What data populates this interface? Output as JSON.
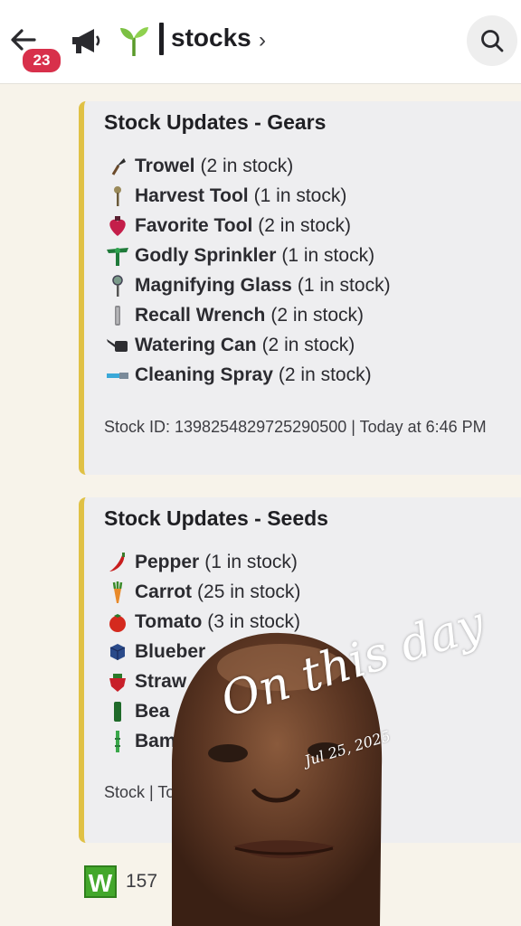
{
  "header": {
    "badge_count": "23",
    "channel_name": "stocks",
    "chevron": "›"
  },
  "embeds": [
    {
      "title": "Stock Updates - Gears",
      "items": [
        {
          "icon": "trowel-icon",
          "name": "Trowel",
          "stock": "(2 in stock)"
        },
        {
          "icon": "harvest-tool-icon",
          "name": "Harvest Tool",
          "stock": "(1 in stock)"
        },
        {
          "icon": "favorite-tool-icon",
          "name": "Favorite Tool",
          "stock": "(2 in stock)"
        },
        {
          "icon": "godly-sprinkler-icon",
          "name": "Godly Sprinkler",
          "stock": "(1 in stock)"
        },
        {
          "icon": "magnifying-glass-icon",
          "name": "Magnifying Glass",
          "stock": "(1 in stock)"
        },
        {
          "icon": "recall-wrench-icon",
          "name": "Recall Wrench",
          "stock": "(2 in stock)"
        },
        {
          "icon": "watering-can-icon",
          "name": "Watering Can",
          "stock": "(2 in stock)"
        },
        {
          "icon": "cleaning-spray-icon",
          "name": "Cleaning Spray",
          "stock": "(2 in stock)"
        }
      ],
      "footer": "Stock ID: 1398254829725290500 | Today at 6:46 PM"
    },
    {
      "title": "Stock Updates - Seeds",
      "items": [
        {
          "icon": "pepper-icon",
          "name": "Pepper",
          "stock": "(1 in stock)"
        },
        {
          "icon": "carrot-icon",
          "name": "Carrot",
          "stock": "(25 in stock)"
        },
        {
          "icon": "tomato-icon",
          "name": "Tomato",
          "stock": "(3 in stock)"
        },
        {
          "icon": "blueberry-icon",
          "name": "Blueber",
          "stock": ""
        },
        {
          "icon": "strawberry-icon",
          "name": "Straw",
          "stock": ""
        },
        {
          "icon": "bean-icon",
          "name": "Bea",
          "stock": ""
        },
        {
          "icon": "bamboo-icon",
          "name": "Bam",
          "stock": ""
        }
      ],
      "footer": "Stock | Today at 6:46 PM"
    }
  ],
  "reactions": [
    {
      "icon": "w-emoji-icon",
      "count": "157"
    }
  ],
  "overlay": {
    "title": "On this day",
    "date": "Jul 25, 2025"
  },
  "colors": {
    "accent_bar": "#e0c145",
    "badge": "#d8304b",
    "embed_bg": "#eeeef0",
    "page_bg": "#f7f3ea"
  }
}
